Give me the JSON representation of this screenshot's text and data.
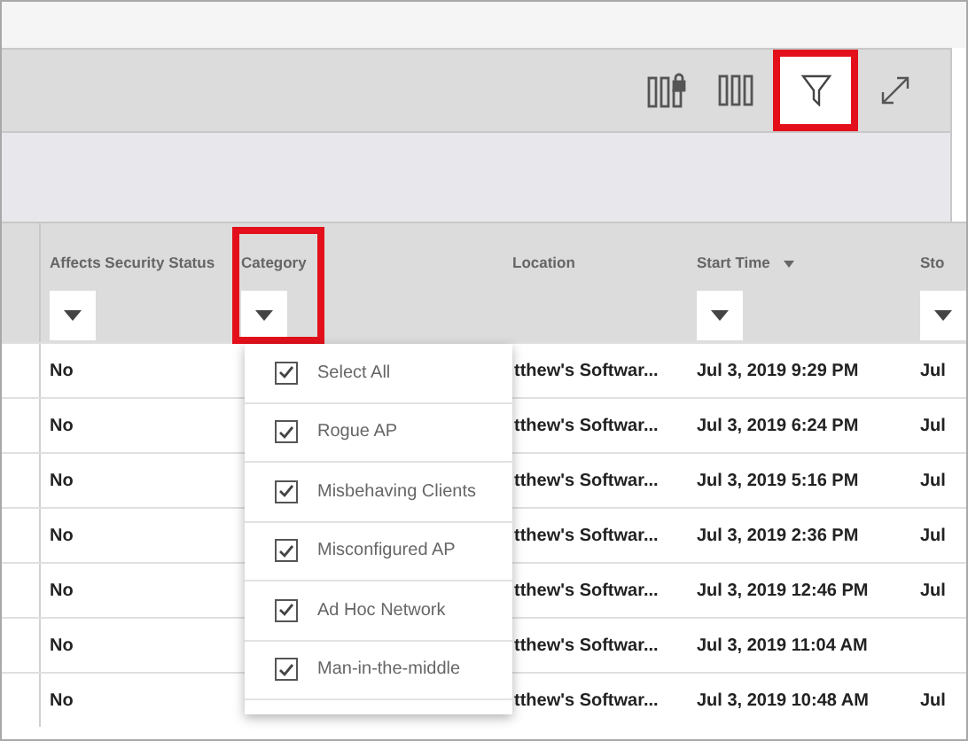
{
  "toolbar": {
    "buttons": [
      {
        "kind": "lock-columns",
        "highlighted": false
      },
      {
        "kind": "columns",
        "highlighted": false
      },
      {
        "kind": "filter",
        "highlighted": true
      },
      {
        "kind": "expand",
        "highlighted": false
      }
    ]
  },
  "table": {
    "columns": [
      {
        "label": "Affects Security Status",
        "filter": true,
        "sorted": false,
        "highlighted": false
      },
      {
        "label": "Category",
        "filter": true,
        "sorted": false,
        "highlighted": true
      },
      {
        "label": "Location",
        "filter": false,
        "sorted": false,
        "highlighted": false
      },
      {
        "label": "Start Time",
        "filter": true,
        "sorted": true,
        "highlighted": false
      },
      {
        "label": "Sto",
        "filter": true,
        "sorted": false,
        "highlighted": false
      }
    ],
    "rows": [
      {
        "affects_security_status": "No",
        "location": "tthew's Softwar...",
        "start_time": "Jul 3, 2019 9:29 PM",
        "column_5": "Jul"
      },
      {
        "affects_security_status": "No",
        "location": "tthew's Softwar...",
        "start_time": "Jul 3, 2019 6:24 PM",
        "column_5": "Jul"
      },
      {
        "affects_security_status": "No",
        "location": "tthew's Softwar...",
        "start_time": "Jul 3, 2019 5:16 PM",
        "column_5": "Jul"
      },
      {
        "affects_security_status": "No",
        "location": "tthew's Softwar...",
        "start_time": "Jul 3, 2019 2:36 PM",
        "column_5": "Jul"
      },
      {
        "affects_security_status": "No",
        "location": "tthew's Softwar...",
        "start_time": "Jul 3, 2019 12:46 PM",
        "column_5": "Jul"
      },
      {
        "affects_security_status": "No",
        "location": "tthew's Softwar...",
        "start_time": "Jul 3, 2019 11:04 AM"
      },
      {
        "affects_security_status": "No",
        "location": "tthew's Softwar...",
        "start_time": "Jul 3, 2019 10:48 AM",
        "column_5": "Jul"
      }
    ]
  },
  "category_filter_menu": {
    "items": [
      {
        "label": "Select All",
        "checked": true
      },
      {
        "label": "Rogue AP",
        "checked": true
      },
      {
        "label": "Misbehaving Clients",
        "checked": true
      },
      {
        "label": "Misconfigured AP",
        "checked": true
      },
      {
        "label": "Ad Hoc Network",
        "checked": true
      },
      {
        "label": "Man-in-the-middle",
        "checked": true
      }
    ]
  }
}
